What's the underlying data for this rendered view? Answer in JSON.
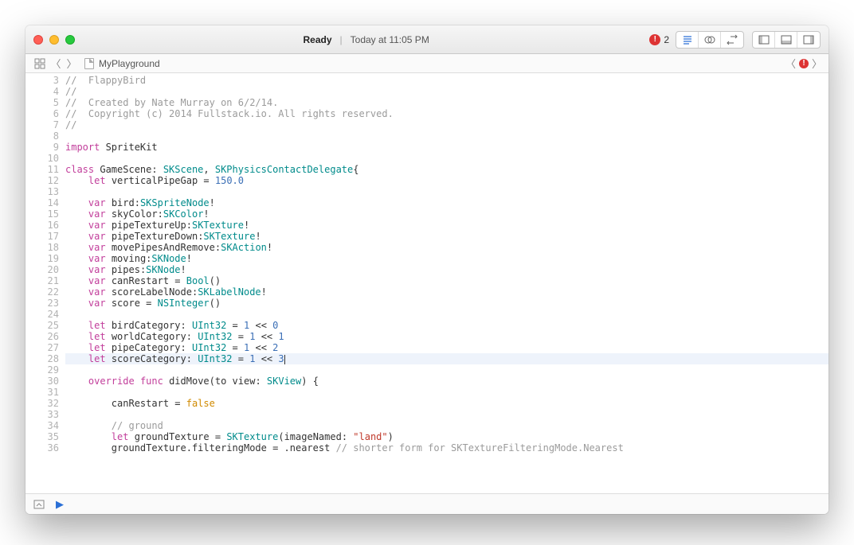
{
  "titlebar": {
    "status": "Ready",
    "time": "Today at 11:05 PM",
    "error_count": "2"
  },
  "pathbar": {
    "filename": "MyPlayground"
  },
  "gutter": {
    "start": 3,
    "end": 36
  },
  "code": {
    "lines": [
      [
        [
          "c",
          "//  FlappyBird"
        ]
      ],
      [
        [
          "c",
          "//"
        ]
      ],
      [
        [
          "c",
          "//  Created by Nate Murray on 6/2/14."
        ]
      ],
      [
        [
          "c",
          "//  Copyright (c) 2014 Fullstack.io. All rights reserved."
        ]
      ],
      [
        [
          "c",
          "//"
        ]
      ],
      [],
      [
        [
          "k",
          "import"
        ],
        [
          "p",
          " SpriteKit"
        ]
      ],
      [],
      [
        [
          "k",
          "class"
        ],
        [
          "p",
          " GameScene: "
        ],
        [
          "t",
          "SKScene"
        ],
        [
          "p",
          ", "
        ],
        [
          "t",
          "SKPhysicsContactDelegate"
        ],
        [
          "p",
          "{"
        ]
      ],
      [
        [
          "p",
          "    "
        ],
        [
          "k",
          "let"
        ],
        [
          "p",
          " verticalPipeGap = "
        ],
        [
          "n",
          "150.0"
        ]
      ],
      [],
      [
        [
          "p",
          "    "
        ],
        [
          "k",
          "var"
        ],
        [
          "p",
          " bird:"
        ],
        [
          "t",
          "SKSpriteNode"
        ],
        [
          "p",
          "!"
        ]
      ],
      [
        [
          "p",
          "    "
        ],
        [
          "k",
          "var"
        ],
        [
          "p",
          " skyColor:"
        ],
        [
          "t",
          "SKColor"
        ],
        [
          "p",
          "!"
        ]
      ],
      [
        [
          "p",
          "    "
        ],
        [
          "k",
          "var"
        ],
        [
          "p",
          " pipeTextureUp:"
        ],
        [
          "t",
          "SKTexture"
        ],
        [
          "p",
          "!"
        ]
      ],
      [
        [
          "p",
          "    "
        ],
        [
          "k",
          "var"
        ],
        [
          "p",
          " pipeTextureDown:"
        ],
        [
          "t",
          "SKTexture"
        ],
        [
          "p",
          "!"
        ]
      ],
      [
        [
          "p",
          "    "
        ],
        [
          "k",
          "var"
        ],
        [
          "p",
          " movePipesAndRemove:"
        ],
        [
          "t",
          "SKAction"
        ],
        [
          "p",
          "!"
        ]
      ],
      [
        [
          "p",
          "    "
        ],
        [
          "k",
          "var"
        ],
        [
          "p",
          " moving:"
        ],
        [
          "t",
          "SKNode"
        ],
        [
          "p",
          "!"
        ]
      ],
      [
        [
          "p",
          "    "
        ],
        [
          "k",
          "var"
        ],
        [
          "p",
          " pipes:"
        ],
        [
          "t",
          "SKNode"
        ],
        [
          "p",
          "!"
        ]
      ],
      [
        [
          "p",
          "    "
        ],
        [
          "k",
          "var"
        ],
        [
          "p",
          " canRestart = "
        ],
        [
          "t",
          "Bool"
        ],
        [
          "p",
          "()"
        ]
      ],
      [
        [
          "p",
          "    "
        ],
        [
          "k",
          "var"
        ],
        [
          "p",
          " scoreLabelNode:"
        ],
        [
          "t",
          "SKLabelNode"
        ],
        [
          "p",
          "!"
        ]
      ],
      [
        [
          "p",
          "    "
        ],
        [
          "k",
          "var"
        ],
        [
          "p",
          " score = "
        ],
        [
          "t",
          "NSInteger"
        ],
        [
          "p",
          "()"
        ]
      ],
      [],
      [
        [
          "p",
          "    "
        ],
        [
          "k",
          "let"
        ],
        [
          "p",
          " birdCategory: "
        ],
        [
          "t",
          "UInt32"
        ],
        [
          "p",
          " = "
        ],
        [
          "n",
          "1"
        ],
        [
          "p",
          " << "
        ],
        [
          "n",
          "0"
        ]
      ],
      [
        [
          "p",
          "    "
        ],
        [
          "k",
          "let"
        ],
        [
          "p",
          " worldCategory: "
        ],
        [
          "t",
          "UInt32"
        ],
        [
          "p",
          " = "
        ],
        [
          "n",
          "1"
        ],
        [
          "p",
          " << "
        ],
        [
          "n",
          "1"
        ]
      ],
      [
        [
          "p",
          "    "
        ],
        [
          "k",
          "let"
        ],
        [
          "p",
          " pipeCategory: "
        ],
        [
          "t",
          "UInt32"
        ],
        [
          "p",
          " = "
        ],
        [
          "n",
          "1"
        ],
        [
          "p",
          " << "
        ],
        [
          "n",
          "2"
        ]
      ],
      [
        [
          "p",
          "    "
        ],
        [
          "k",
          "let"
        ],
        [
          "p",
          " scoreCategory: "
        ],
        [
          "t",
          "UInt32"
        ],
        [
          "p",
          " = "
        ],
        [
          "n",
          "1"
        ],
        [
          "p",
          " << "
        ],
        [
          "n",
          "3"
        ]
      ],
      [],
      [
        [
          "p",
          "    "
        ],
        [
          "k",
          "override"
        ],
        [
          "p",
          " "
        ],
        [
          "k",
          "func"
        ],
        [
          "p",
          " didMove(to view: "
        ],
        [
          "t",
          "SKView"
        ],
        [
          "p",
          ") {"
        ]
      ],
      [],
      [
        [
          "p",
          "        canRestart = "
        ],
        [
          "br",
          "false"
        ]
      ],
      [],
      [
        [
          "p",
          "        "
        ],
        [
          "c",
          "// ground"
        ]
      ],
      [
        [
          "p",
          "        "
        ],
        [
          "k",
          "let"
        ],
        [
          "p",
          " groundTexture = "
        ],
        [
          "t",
          "SKTexture"
        ],
        [
          "p",
          "(imageNamed: "
        ],
        [
          "s",
          "\"land\""
        ],
        [
          "p",
          ")"
        ]
      ],
      [
        [
          "p",
          "        groundTexture.filteringMode = .nearest "
        ],
        [
          "c",
          "// shorter form for SKTextureFilteringMode.Nearest"
        ]
      ]
    ],
    "highlight_line": 28
  }
}
